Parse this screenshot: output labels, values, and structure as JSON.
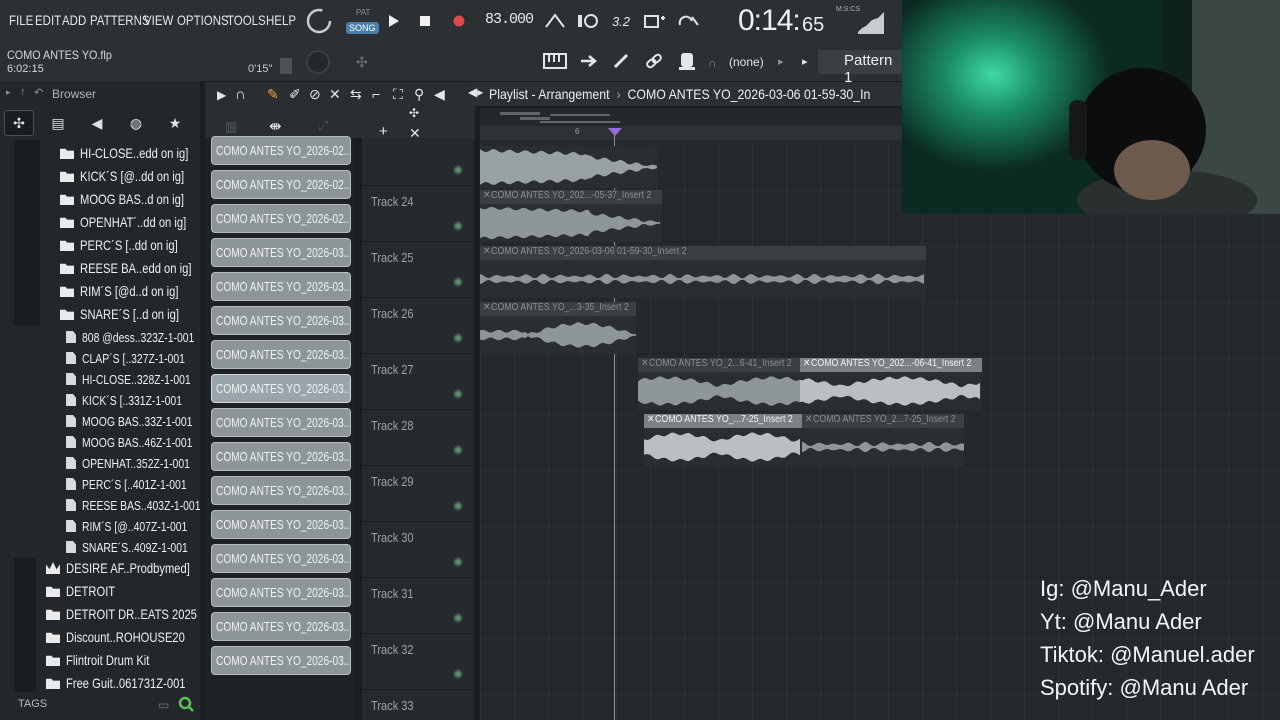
{
  "menu": [
    "FILE",
    "EDIT",
    "ADD",
    "PATTERNS",
    "VIEW",
    "OPTIONS",
    "TOOLS",
    "HELP"
  ],
  "transport": {
    "pat_label": "PAT",
    "song_label": "SONG",
    "bpm": "83.000",
    "time_main": "0:14:",
    "time_small": "65",
    "time_label": "M:S:CS",
    "snap_value": "3.2"
  },
  "project": {
    "file_name": "COMO ANTES YO.flp",
    "file_time": "6:02:15",
    "time_offset": "0'15\""
  },
  "pattern": {
    "none_label": "(none)",
    "name": "Pattern 1"
  },
  "browser": {
    "title": "Browser",
    "tags_label": "TAGS",
    "items": [
      {
        "label": "HI-CLOSE..edd on ig]",
        "type": "folder"
      },
      {
        "label": "KICK´S [@..dd on ig]",
        "type": "folder"
      },
      {
        "label": "MOOG BAS..d on ig]",
        "type": "folder"
      },
      {
        "label": "OPENHAT´..dd on ig]",
        "type": "folder"
      },
      {
        "label": "PERC´S [..dd on ig]",
        "type": "folder"
      },
      {
        "label": "REESE BA..edd on ig]",
        "type": "folder"
      },
      {
        "label": "RIM´S [@d..d on ig]",
        "type": "folder"
      },
      {
        "label": "SNARE´S [..d on ig]",
        "type": "folder"
      },
      {
        "label": "808 @dess..323Z-1-001",
        "type": "file"
      },
      {
        "label": "CLAP´S [..327Z-1-001",
        "type": "file"
      },
      {
        "label": "HI-CLOSE..328Z-1-001",
        "type": "file"
      },
      {
        "label": "KICK´S [..331Z-1-001",
        "type": "file"
      },
      {
        "label": "MOOG BAS..33Z-1-001",
        "type": "file"
      },
      {
        "label": "MOOG BAS..46Z-1-001",
        "type": "file"
      },
      {
        "label": "OPENHAT..352Z-1-001",
        "type": "file"
      },
      {
        "label": "PERC´S [..401Z-1-001",
        "type": "file"
      },
      {
        "label": "REESE BAS..403Z-1-001",
        "type": "file"
      },
      {
        "label": "RIM´S [@..407Z-1-001",
        "type": "file"
      },
      {
        "label": "SNARE´S..409Z-1-001",
        "type": "file"
      },
      {
        "label": "DESIRE AF..Prodbymed]",
        "type": "crown"
      },
      {
        "label": "DETROIT",
        "type": "folder"
      },
      {
        "label": "DETROIT DR..EATS 2025",
        "type": "folder"
      },
      {
        "label": "Discount..ROHOUSE20",
        "type": "folder"
      },
      {
        "label": "Flintroit Drum Kit",
        "type": "folder"
      },
      {
        "label": "Free Guit..061731Z-001",
        "type": "folder"
      }
    ]
  },
  "clips": [
    "COMO ANTES YO_2026-02...",
    "COMO ANTES YO_2026-02...",
    "COMO ANTES YO_2026-02...",
    "COMO ANTES YO_2026-03...",
    "COMO ANTES YO_2026-03...",
    "COMO ANTES YO_2026-03...",
    "COMO ANTES YO_2026-03...",
    "COMO ANTES YO_2026-03...",
    "COMO ANTES YO_2026-03...",
    "COMO ANTES YO_2026-03...",
    "COMO ANTES YO_2026-03...",
    "COMO ANTES YO_2026-03...",
    "COMO ANTES YO_2026-03...",
    "COMO ANTES YO_2026-03...",
    "COMO ANTES YO_2026-03...",
    "COMO ANTES YO_2026-03..."
  ],
  "playlist": {
    "title": "Playlist - Arrangement",
    "breadcrumb": "COMO ANTES YO_2026-03-06 01-59-30_In",
    "bar_marker": "6",
    "tracks": [
      "Track 24",
      "Track 25",
      "Track 26",
      "Track 27",
      "Track 28",
      "Track 29",
      "Track 30",
      "Track 31",
      "Track 32",
      "Track 33"
    ],
    "audio_clips": [
      {
        "label": "COMO ANTES YO_202...-05-37_Insert 2"
      },
      {
        "label": "COMO ANTES YO_2026-03-06 01-59-30_Insert 2"
      },
      {
        "label": "COMO ANTES YO_...3-35_Insert 2"
      },
      {
        "label": "COMO ANTES YO_2...6-41_Insert 2"
      },
      {
        "label": "COMO ANTES YO_202...-06-41_Insert 2"
      },
      {
        "label": "COMO ANTES YO_...7-25_Insert 2"
      },
      {
        "label": "COMO ANTES YO_2...7-25_Insert 2"
      }
    ]
  },
  "socials": [
    "Ig: @Manu_Ader",
    "Yt: @Manu Ader",
    "Tiktok: @Manuel.ader",
    "Spotify: @Manu Ader"
  ]
}
